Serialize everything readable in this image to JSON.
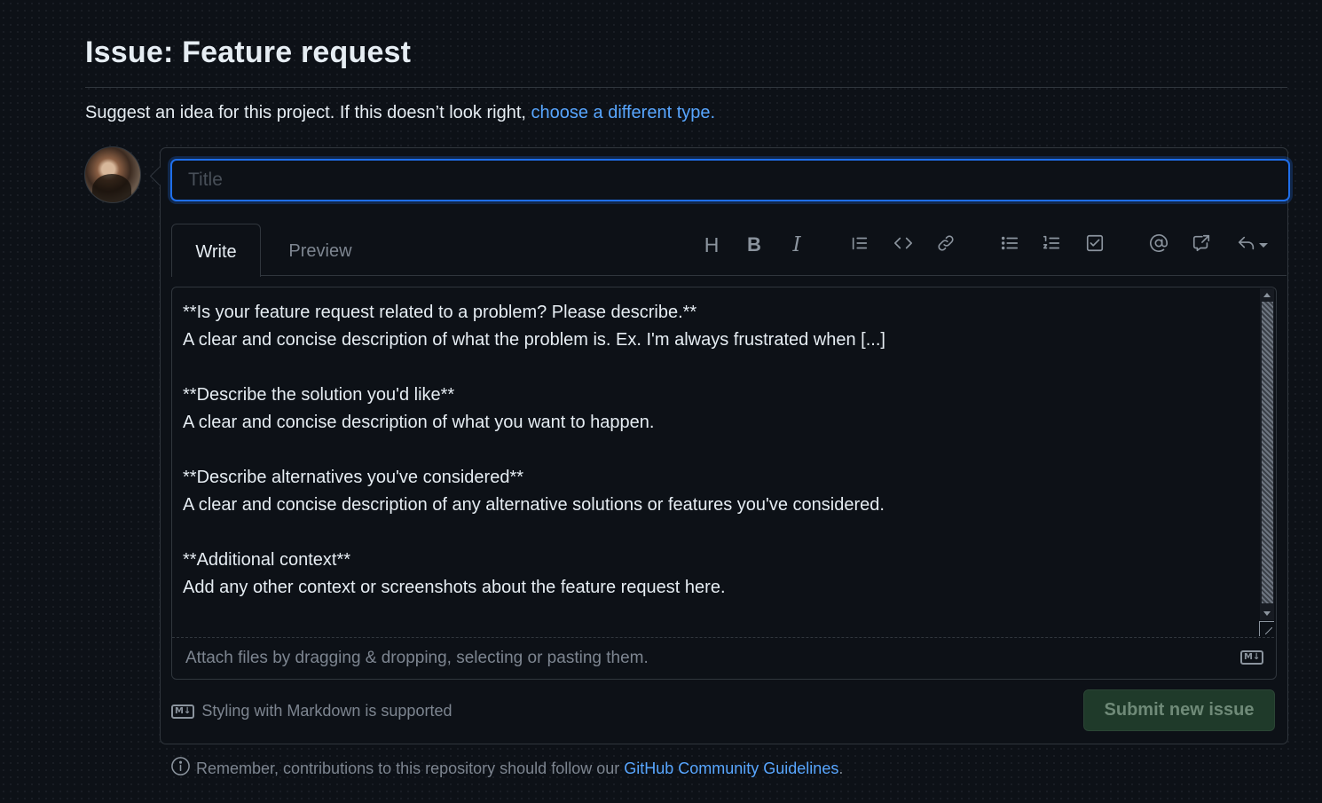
{
  "header": {
    "title": "Issue: Feature request",
    "subtitle_prefix": "Suggest an idea for this project. If this doesn’t look right, ",
    "subtitle_link": "choose a different type."
  },
  "form": {
    "title_placeholder": "Title",
    "title_value": "",
    "tabs": [
      {
        "label": "Write",
        "active": true
      },
      {
        "label": "Preview",
        "active": false
      }
    ],
    "toolbar": [
      {
        "name": "heading-icon",
        "glyph": "H"
      },
      {
        "name": "bold-icon",
        "glyph": "B"
      },
      {
        "name": "italic-icon",
        "glyph": "I"
      },
      {
        "name": "quote-icon"
      },
      {
        "name": "code-icon"
      },
      {
        "name": "link-icon"
      },
      {
        "name": "unordered-list-icon"
      },
      {
        "name": "ordered-list-icon"
      },
      {
        "name": "task-list-icon"
      },
      {
        "name": "mention-icon"
      },
      {
        "name": "cross-reference-icon"
      },
      {
        "name": "reply-icon"
      }
    ],
    "body_text": "**Is your feature request related to a problem? Please describe.**\nA clear and concise description of what the problem is. Ex. I'm always frustrated when [...]\n\n**Describe the solution you'd like**\nA clear and concise description of what you want to happen.\n\n**Describe alternatives you've considered**\nA clear and concise description of any alternative solutions or features you've considered.\n\n**Additional context**\nAdd any other context or screenshots about the feature request here.",
    "attach_hint": "Attach files by dragging & dropping, selecting or pasting them.",
    "markdown_note": "Styling with Markdown is supported",
    "markdown_icon_text": "M↓",
    "submit_label": "Submit new issue"
  },
  "footer": {
    "prefix": "Remember, contributions to this repository should follow our ",
    "link": "GitHub Community Guidelines",
    "suffix": "."
  },
  "colors": {
    "background": "#0d1117",
    "accent_link": "#58a6ff",
    "focus_border": "#1f6feb",
    "submit_bg_disabled": "#1f3a2a"
  }
}
